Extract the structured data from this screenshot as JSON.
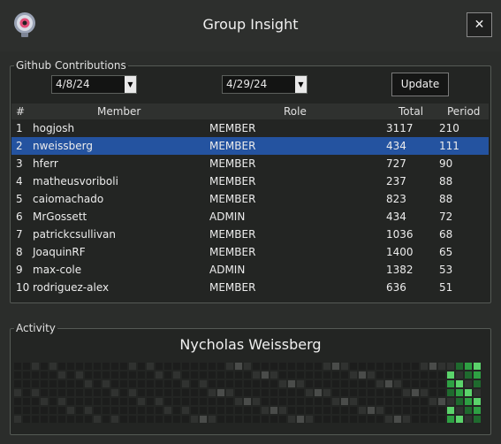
{
  "window": {
    "title": "Group Insight",
    "close_label": "✕"
  },
  "github": {
    "legend": "Github Contributions",
    "date_from": "4/8/24",
    "date_to": "4/29/24",
    "update_label": "Update",
    "columns": {
      "num": "#",
      "member": "Member",
      "role": "Role",
      "total": "Total",
      "period": "Period"
    },
    "rows": [
      {
        "num": "1",
        "member": "hogjosh",
        "role": "MEMBER",
        "total": "3117",
        "period": "210"
      },
      {
        "num": "2",
        "member": "nweissberg",
        "role": "MEMBER",
        "total": "434",
        "period": "111"
      },
      {
        "num": "3",
        "member": "hferr",
        "role": "MEMBER",
        "total": "727",
        "period": "90"
      },
      {
        "num": "4",
        "member": "matheusvoriboli",
        "role": "MEMBER",
        "total": "237",
        "period": "88"
      },
      {
        "num": "5",
        "member": "caiomachado",
        "role": "MEMBER",
        "total": "823",
        "period": "88"
      },
      {
        "num": "6",
        "member": "MrGossett",
        "role": "ADMIN",
        "total": "434",
        "period": "72"
      },
      {
        "num": "7",
        "member": "patrickcsullivan",
        "role": "MEMBER",
        "total": "1036",
        "period": "68"
      },
      {
        "num": "8",
        "member": "JoaquinRF",
        "role": "MEMBER",
        "total": "1400",
        "period": "65"
      },
      {
        "num": "9",
        "member": "max-cole",
        "role": "ADMIN",
        "total": "1382",
        "period": "53"
      },
      {
        "num": "10",
        "member": "rodriguez-alex",
        "role": "MEMBER",
        "total": "636",
        "period": "51"
      }
    ],
    "selected_index": 1
  },
  "activity": {
    "legend": "Activity",
    "user_name": "Nycholas Weissberg",
    "colors": {
      "empty": "#1c1d1c",
      "low": "#303230",
      "mid": "#4a4c4a",
      "green1": "#1f6a2e",
      "green2": "#2ea043",
      "green3": "#5bd36b"
    }
  }
}
